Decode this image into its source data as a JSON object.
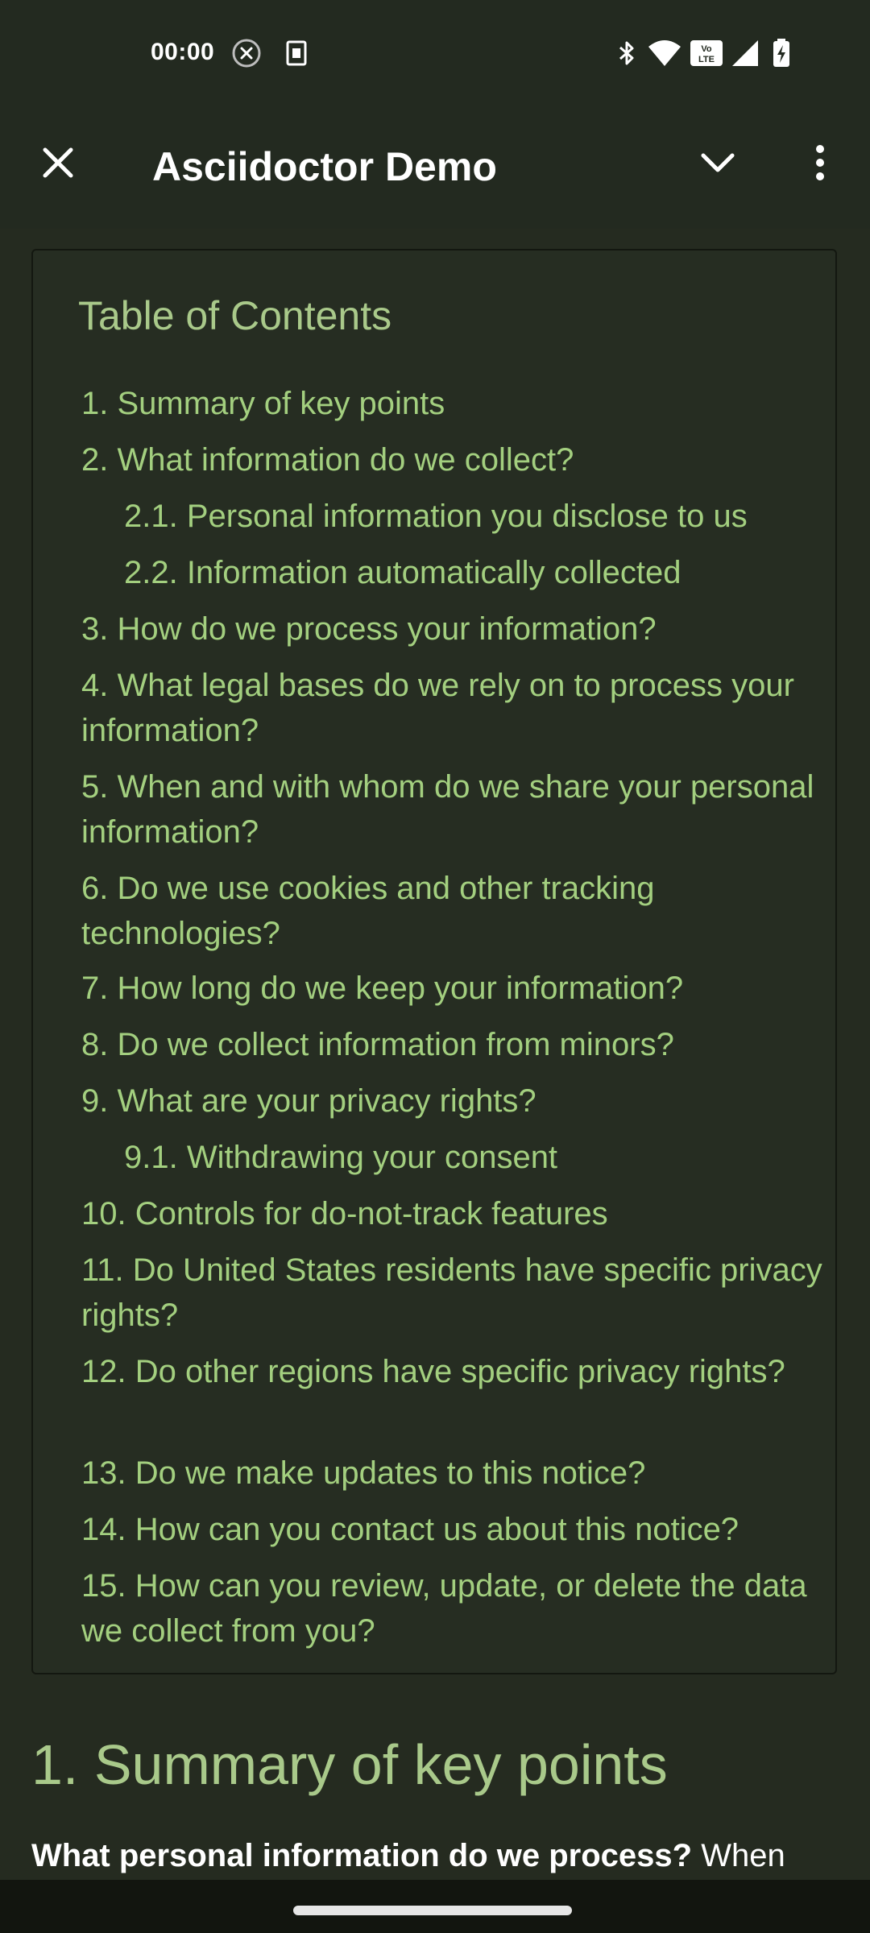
{
  "status_bar": {
    "time": "00:00",
    "icons": [
      "x-circle-icon",
      "sim-icon",
      "bluetooth-icon",
      "wifi-icon",
      "volte-icon",
      "signal-icon",
      "battery-charging-icon"
    ]
  },
  "app_bar": {
    "title": "Asciidoctor Demo",
    "close_icon": "close-icon",
    "dropdown_icon": "chevron-down-icon",
    "menu_icon": "more-vert-icon"
  },
  "toc": {
    "title": "Table of Contents",
    "items": [
      {
        "label": "1. Summary of key points",
        "sub": false
      },
      {
        "label": "2. What information do we collect?",
        "sub": false
      },
      {
        "label": "2.1. Personal information you disclose to us",
        "sub": true
      },
      {
        "label": "2.2. Information automatically collected",
        "sub": true
      },
      {
        "label": "3. How do we process your information?",
        "sub": false
      },
      {
        "label": "4. What legal bases do we rely on to process your information?",
        "sub": false
      },
      {
        "label": "5. When and with whom do we share your personal information?",
        "sub": false
      },
      {
        "label": "6. Do we use cookies and other tracking technologies?",
        "sub": false
      },
      {
        "label": "7. How long do we keep your information?",
        "sub": false
      },
      {
        "label": "8. Do we collect information from minors?",
        "sub": false
      },
      {
        "label": "9. What are your privacy rights?",
        "sub": false
      },
      {
        "label": "9.1. Withdrawing your consent",
        "sub": true
      },
      {
        "label": "10. Controls for do-not-track features",
        "sub": false
      },
      {
        "label": "11. Do United States residents have specific privacy rights?",
        "sub": false
      },
      {
        "label": "12. Do other regions have specific privacy rights?",
        "sub": false
      },
      {
        "label": "13. Do we make updates to this notice?",
        "sub": false
      },
      {
        "label": "14. How can you contact us about this notice?",
        "sub": false
      },
      {
        "label": "15. How can you review, update, or delete the data we collect from you?",
        "sub": false
      }
    ]
  },
  "section": {
    "heading": "1. Summary of key points",
    "para_bold": "What personal information do we process?",
    "para_text": " When"
  },
  "colors": {
    "background": "#252b20",
    "link": "#a3cf7f",
    "heading": "#a9c98a"
  }
}
